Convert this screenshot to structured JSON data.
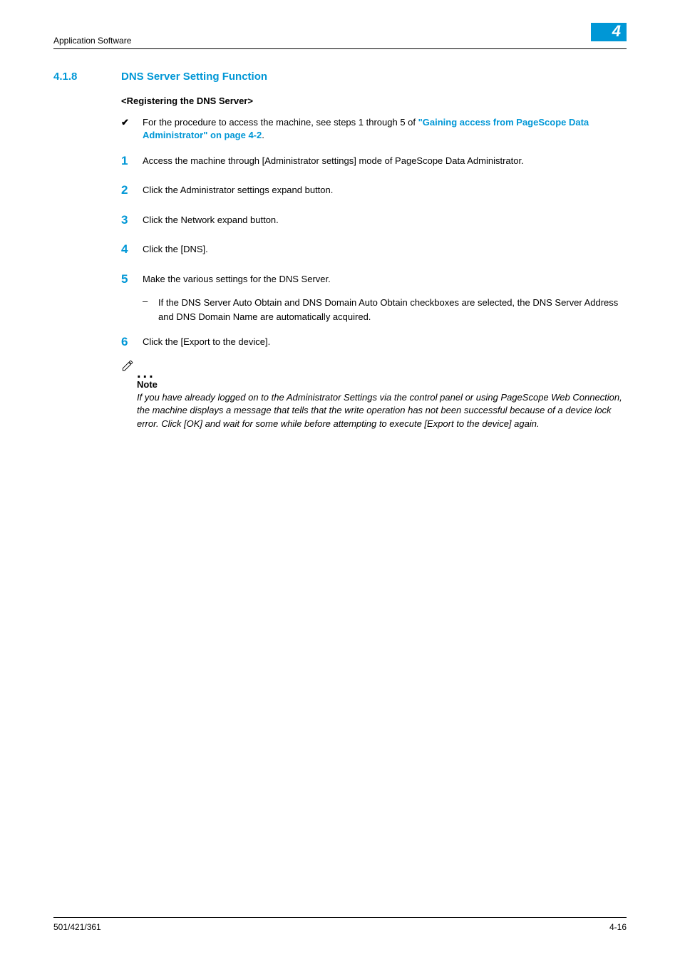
{
  "header": {
    "running_head": "Application Software",
    "chapter_number": "4"
  },
  "section": {
    "number": "4.1.8",
    "title": "DNS Server Setting Function"
  },
  "subheading": "<Registering the DNS Server>",
  "prereq": {
    "checkmark": "✔",
    "text_before": "For the procedure to access the machine, see steps 1 through 5 of ",
    "link_text": "\"Gaining access from PageScope Data Administrator\" on page 4-2",
    "text_after": "."
  },
  "steps": [
    {
      "n": "1",
      "text": "Access the machine through [Administrator settings] mode of PageScope Data Administrator."
    },
    {
      "n": "2",
      "text": "Click the Administrator settings expand button."
    },
    {
      "n": "3",
      "text": "Click the Network expand button."
    },
    {
      "n": "4",
      "text": "Click the [DNS]."
    },
    {
      "n": "5",
      "text": "Make the various settings for the DNS Server."
    },
    {
      "n": "6",
      "text": "Click the [Export to the device]."
    }
  ],
  "substep": {
    "dash": "–",
    "text": "If the DNS Server Auto Obtain and DNS Domain Auto Obtain checkboxes are selected, the DNS Server Address and DNS Domain Name are automatically acquired."
  },
  "note": {
    "label": "Note",
    "body": "If you have already logged on to the Administrator Settings via the control panel or using PageScope Web Connection, the machine displays a message that tells that the write operation has not been successful because of a device lock error. Click [OK] and wait for some while before attempting to execute [Export to the device] again."
  },
  "footer": {
    "left": "501/421/361",
    "right": "4-16"
  }
}
